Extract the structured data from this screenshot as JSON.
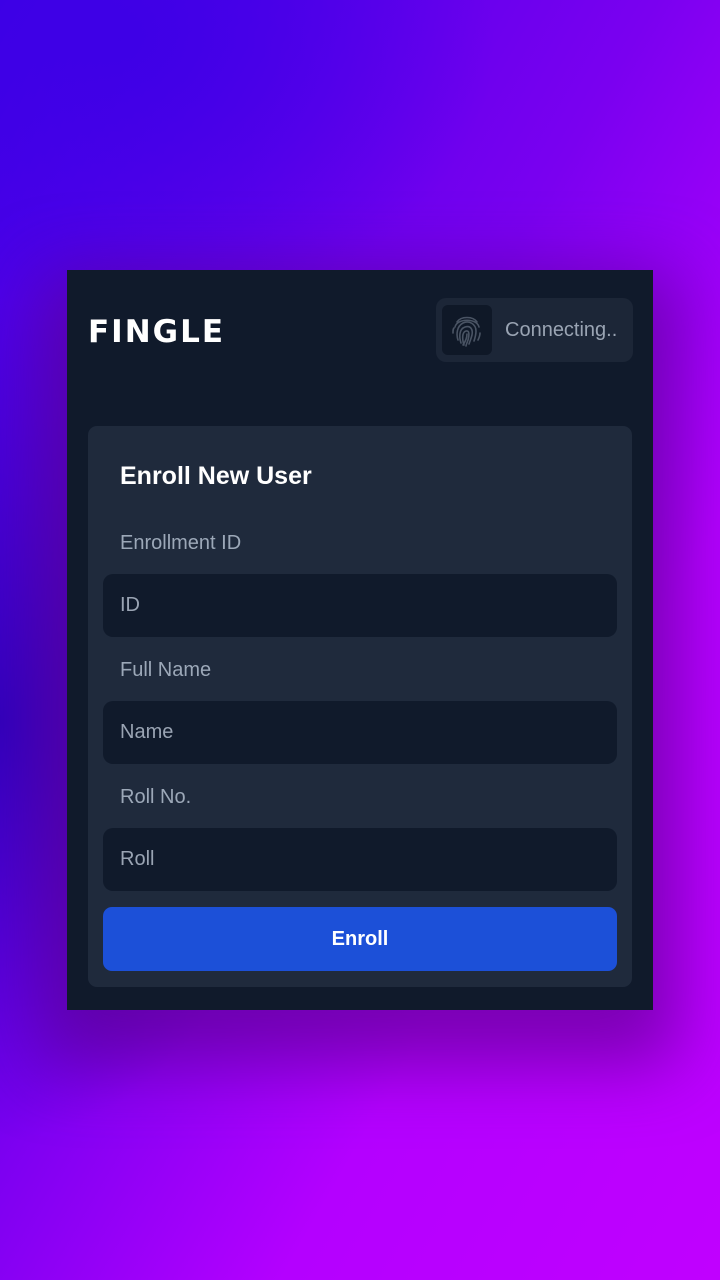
{
  "app": {
    "brand": "FINGLE"
  },
  "status": {
    "icon": "fingerprint-icon",
    "text": "Connecting.."
  },
  "form": {
    "title": "Enroll New User",
    "fields": [
      {
        "label": "Enrollment ID",
        "placeholder": "ID",
        "value": ""
      },
      {
        "label": "Full Name",
        "placeholder": "Name",
        "value": ""
      },
      {
        "label": "Roll No.",
        "placeholder": "Roll",
        "value": ""
      }
    ],
    "submit_label": "Enroll"
  },
  "colors": {
    "app_background": "#101a2b",
    "card_background": "#1f2a3c",
    "accent": "#1c50d8",
    "gradient_left": "#3d00e6",
    "gradient_right": "#c000ff"
  }
}
